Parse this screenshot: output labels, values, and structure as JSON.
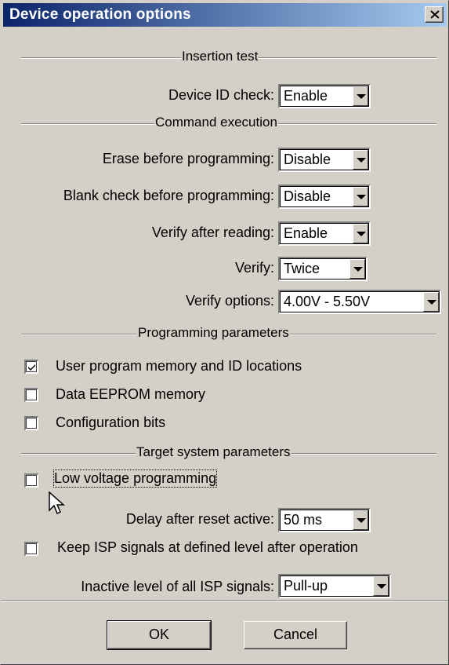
{
  "window": {
    "title": "Device operation options"
  },
  "sections": {
    "insertion": "Insertion test",
    "command": "Command execution",
    "programming": "Programming parameters",
    "target": "Target system parameters"
  },
  "fields": {
    "device_id_check": {
      "label": "Device ID check:",
      "value": "Enable"
    },
    "erase_before": {
      "label": "Erase before programming:",
      "value": "Disable"
    },
    "blank_check": {
      "label": "Blank check before programming:",
      "value": "Disable"
    },
    "verify_after_read": {
      "label": "Verify after reading:",
      "value": "Enable"
    },
    "verify": {
      "label": "Verify:",
      "value": "Twice"
    },
    "verify_options": {
      "label": "Verify options:",
      "value": "4.00V - 5.50V"
    },
    "delay_reset": {
      "label": "Delay after reset active:",
      "value": "50 ms"
    },
    "inactive_level": {
      "label": "Inactive level of all ISP signals:",
      "value": "Pull-up"
    }
  },
  "checkboxes": {
    "user_program": {
      "label": "User program memory and ID locations",
      "checked": true
    },
    "data_eeprom": {
      "label": "Data EEPROM memory",
      "checked": false
    },
    "config_bits": {
      "label": "Configuration bits",
      "checked": false
    },
    "low_voltage": {
      "label": "Low voltage programming",
      "checked": false
    },
    "keep_isp": {
      "label": "Keep ISP signals at defined level after operation",
      "checked": false
    }
  },
  "buttons": {
    "ok": "OK",
    "cancel": "Cancel"
  }
}
